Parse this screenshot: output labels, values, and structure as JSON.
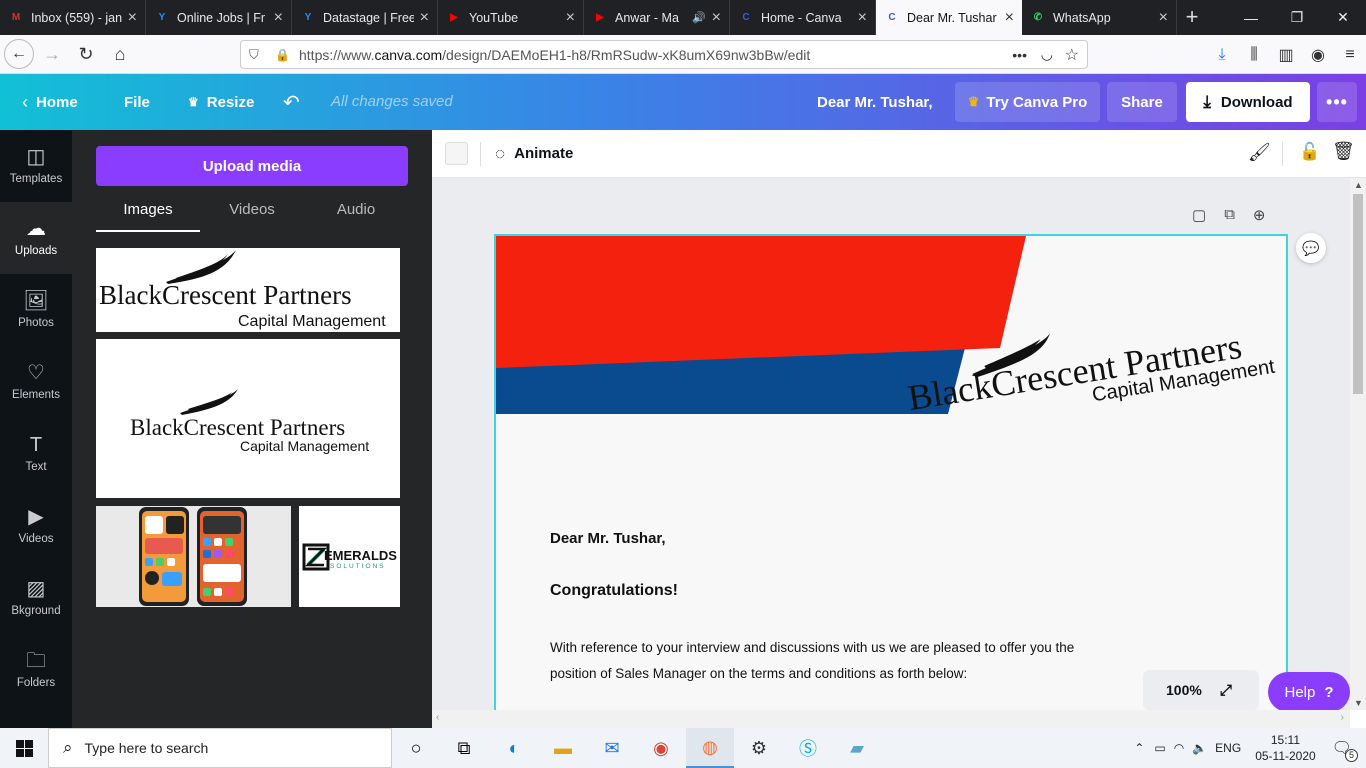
{
  "browser": {
    "tabs": [
      {
        "title": "Inbox (559) - jan",
        "icon": "gmail-icon",
        "color": "#d93025",
        "glyph": "M",
        "active": false,
        "extra": ""
      },
      {
        "title": "Online Jobs | Fr",
        "icon": "upwork-icon",
        "color": "#1e90ff",
        "glyph": "Y",
        "active": false,
        "extra": ""
      },
      {
        "title": "Datastage | Free",
        "icon": "upwork-icon",
        "color": "#1e90ff",
        "glyph": "Y",
        "active": false,
        "extra": ""
      },
      {
        "title": "YouTube",
        "icon": "youtube-icon",
        "color": "#ff0000",
        "glyph": "▶",
        "active": false,
        "extra": ""
      },
      {
        "title": "Anwar - Ma",
        "icon": "youtube-icon",
        "color": "#ff0000",
        "glyph": "▶",
        "active": false,
        "extra": "🔊"
      },
      {
        "title": "Home - Canva",
        "icon": "canva-icon",
        "color": "#3b5bdb",
        "glyph": "C",
        "active": false,
        "extra": ""
      },
      {
        "title": "Dear Mr. Tushar",
        "icon": "canva-icon",
        "color": "#3b5bdb",
        "glyph": "C",
        "active": true,
        "extra": ""
      },
      {
        "title": "WhatsApp",
        "icon": "whatsapp-icon",
        "color": "#25d366",
        "glyph": "✆",
        "active": false,
        "extra": ""
      }
    ],
    "url_prefix": "https://www.",
    "url_domain": "canva.com",
    "url_rest": "/design/DAEMoEH1-h8/RmRSudw-xK8umX69nw3bBw/edit"
  },
  "canva_header": {
    "home": "Home",
    "file": "File",
    "resize": "Resize",
    "saved": "All changes saved",
    "doc_title": "Dear Mr. Tushar,",
    "try_pro": "Try Canva Pro",
    "share": "Share",
    "download": "Download"
  },
  "sidebar": {
    "items": [
      {
        "label": "Templates",
        "icon": "templates-icon",
        "glyph": "◫"
      },
      {
        "label": "Uploads",
        "icon": "upload-cloud-icon",
        "glyph": "☁"
      },
      {
        "label": "Photos",
        "icon": "photos-icon",
        "glyph": "🖼"
      },
      {
        "label": "Elements",
        "icon": "elements-icon",
        "glyph": "♡"
      },
      {
        "label": "Text",
        "icon": "text-icon",
        "glyph": "T"
      },
      {
        "label": "Videos",
        "icon": "videos-icon",
        "glyph": "▶"
      },
      {
        "label": "Bkground",
        "icon": "background-icon",
        "glyph": "▨"
      },
      {
        "label": "Folders",
        "icon": "folder-icon",
        "glyph": "🗀"
      }
    ],
    "selected": "Uploads"
  },
  "panel": {
    "upload_button": "Upload media",
    "tabs": [
      "Images",
      "Videos",
      "Audio"
    ],
    "selected_tab": "Images",
    "logo_name": "BlackCrescent Partners",
    "logo_sub": "Capital Management",
    "emeralds_main": "EMERALDS",
    "emeralds_sub": "SOLUTIONS"
  },
  "toolbar": {
    "animate": "Animate"
  },
  "letter": {
    "logo_name": "BlackCrescent Partners",
    "logo_sub": "Capital Management",
    "salutation": "Dear Mr. Tushar,",
    "greeting": "Congratulations!",
    "body_line1": "With reference to your interview and discussions with us we are pleased to offer you the",
    "body_line2": "position of Sales Manager on the terms and conditions as forth below:"
  },
  "zoom": {
    "level": "100%",
    "help": "Help",
    "help_glyph": "?"
  },
  "taskbar": {
    "search_placeholder": "Type here to search",
    "language": "ENG",
    "time": "15:11",
    "date": "05-11-2020",
    "notifications": "5"
  },
  "colors": {
    "accent_purple": "#8b3dff",
    "letter_red": "#f5210f",
    "letter_blue": "#0a4a8f",
    "selection_cyan": "#3ad6e5"
  }
}
